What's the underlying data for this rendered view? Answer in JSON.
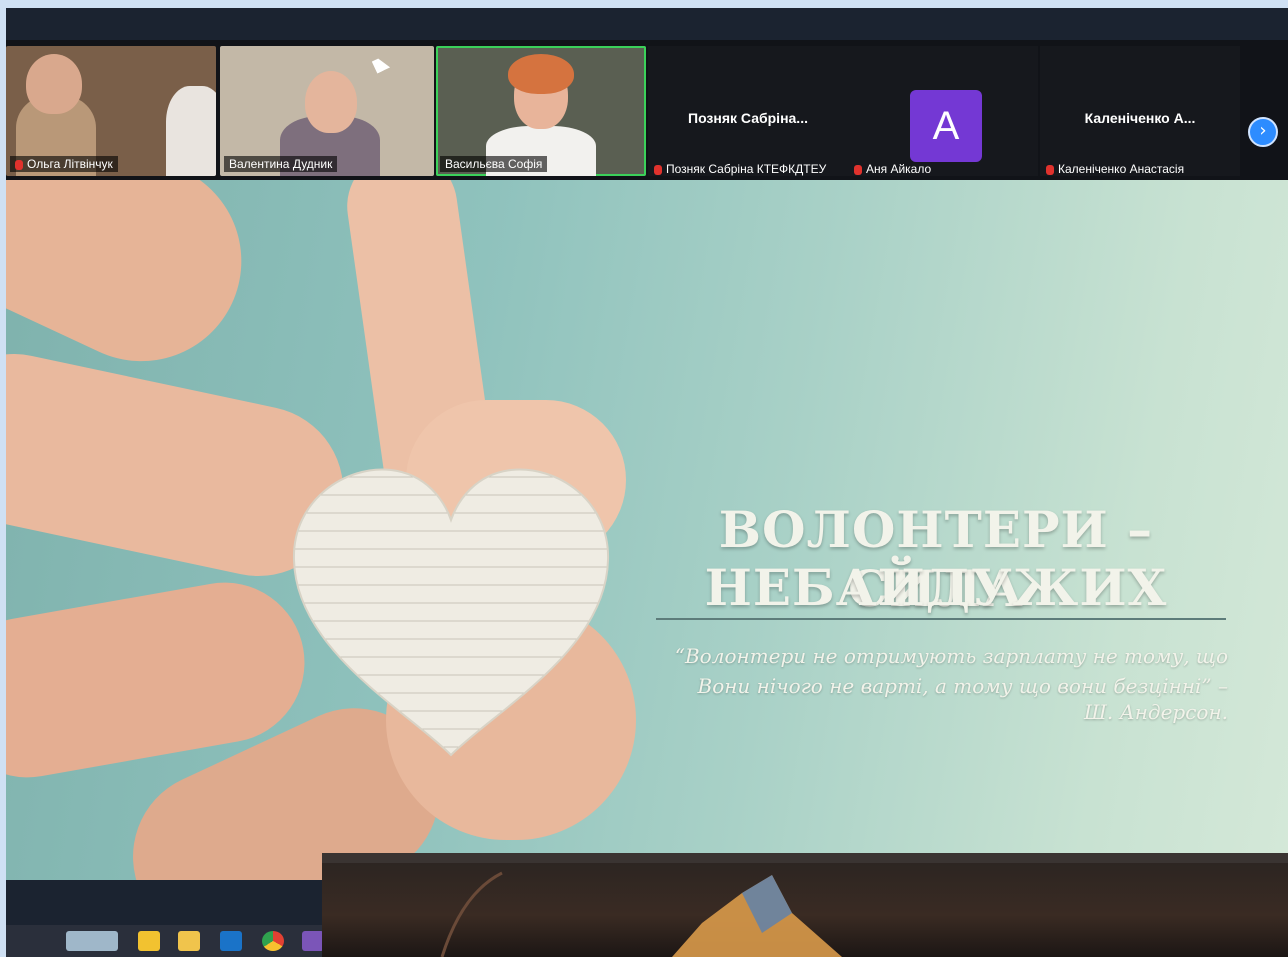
{
  "participants": [
    {
      "name": "Ольга Літвінчук",
      "muted": true
    },
    {
      "name": "Валентина Дудник",
      "muted": false
    },
    {
      "name": "Васильєва Софія",
      "muted": false,
      "active": true
    },
    {
      "display": "Позняк Сабріна...",
      "name": "Позняк Сабріна КТЕФКДТЕУ",
      "muted": true
    },
    {
      "avatar_letter": "A",
      "name": "Аня Айкало",
      "muted": true
    },
    {
      "display": "Каленіченко А...",
      "name": "Каленіченко Анастасія",
      "muted": true
    }
  ],
  "slide": {
    "title_line1": "ВОЛОНТЕРИ – СИЛА",
    "title_line2": "НЕБАЙДУЖИХ",
    "quote_line1": "“Волонтери не отримують зарплату не тому, що",
    "quote_line2": "Вони нічого не варті, а тому що вони безцінні” –",
    "quote_author": "Ш. Андерсон."
  },
  "icons": {
    "next_page": "chevron-right-icon",
    "mic_muted": "mic-muted-icon"
  },
  "colors": {
    "active_speaker": "#3bd15a",
    "avatar_bg": "#7438d4",
    "zoom_blue": "#2d8cff",
    "muted_red": "#e0322d"
  }
}
